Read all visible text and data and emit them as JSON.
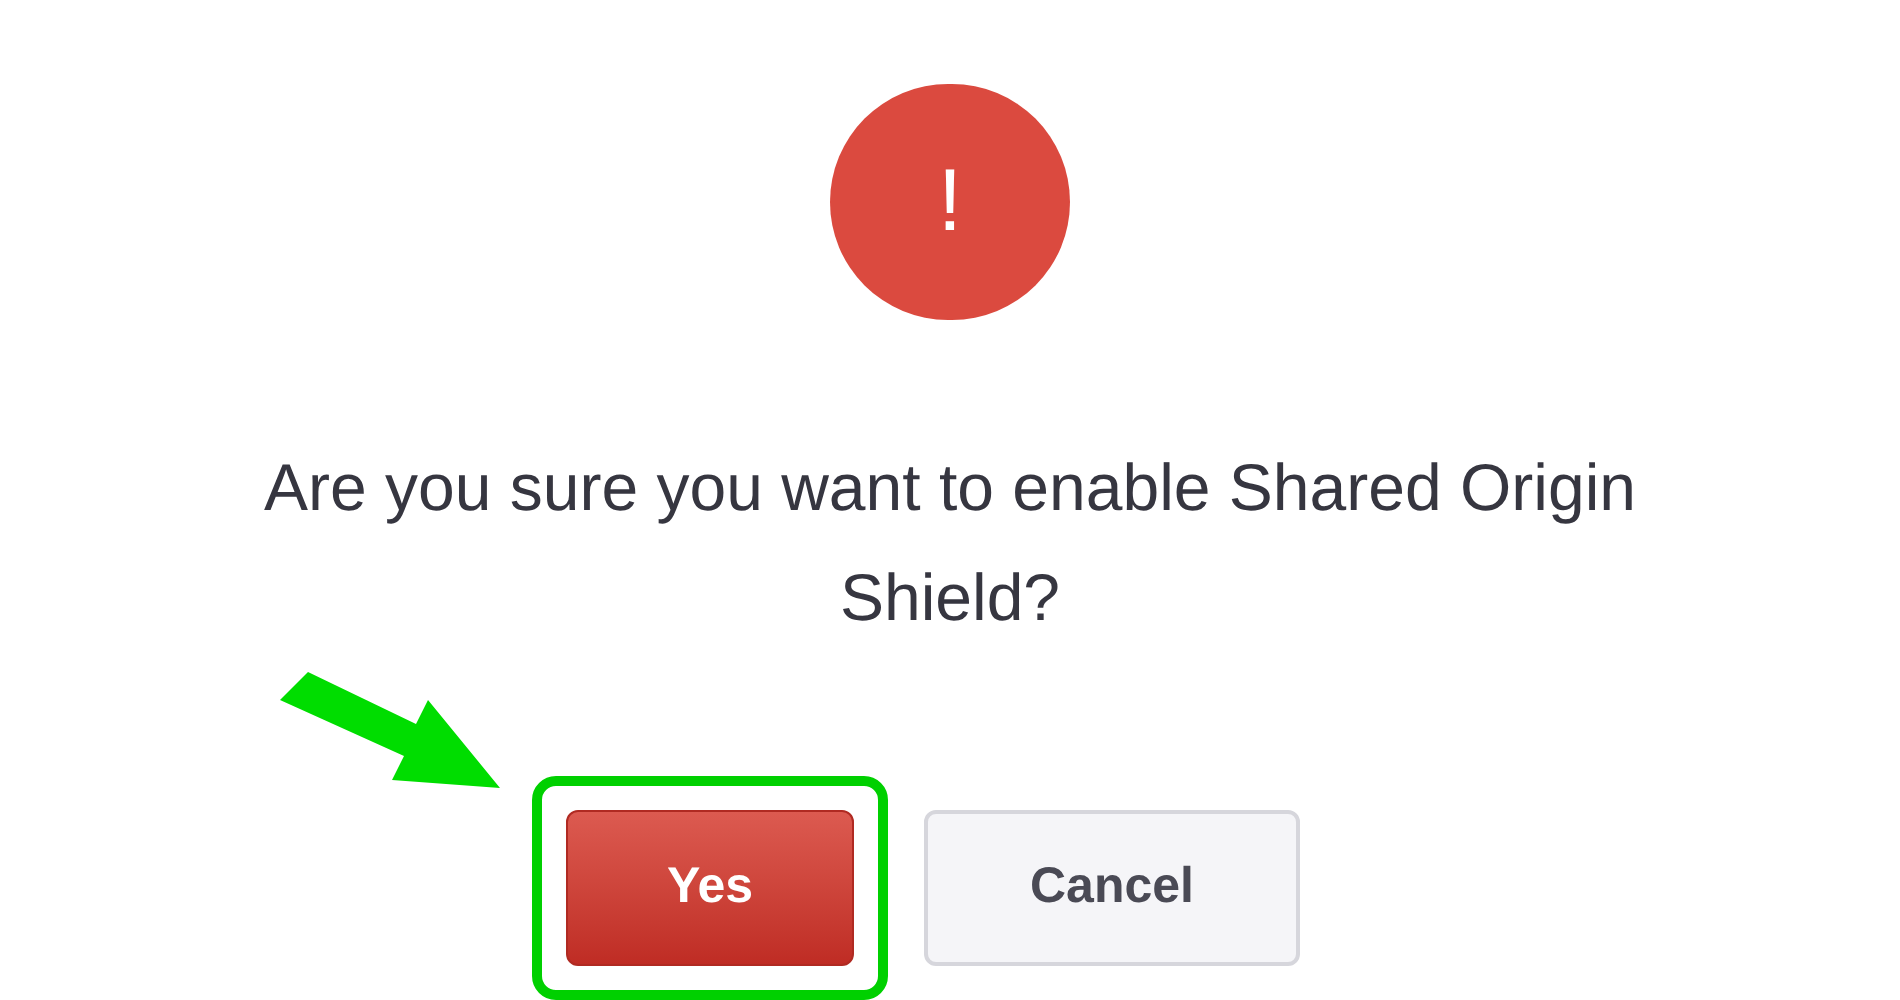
{
  "dialog": {
    "icon": "!",
    "message": "Are you sure you want to enable Shared Origin Shield?",
    "buttons": [
      {
        "label": "Yes",
        "kind": "primary",
        "highlighted": true
      },
      {
        "label": "Cancel",
        "kind": "secondary",
        "highlighted": false
      }
    ]
  }
}
